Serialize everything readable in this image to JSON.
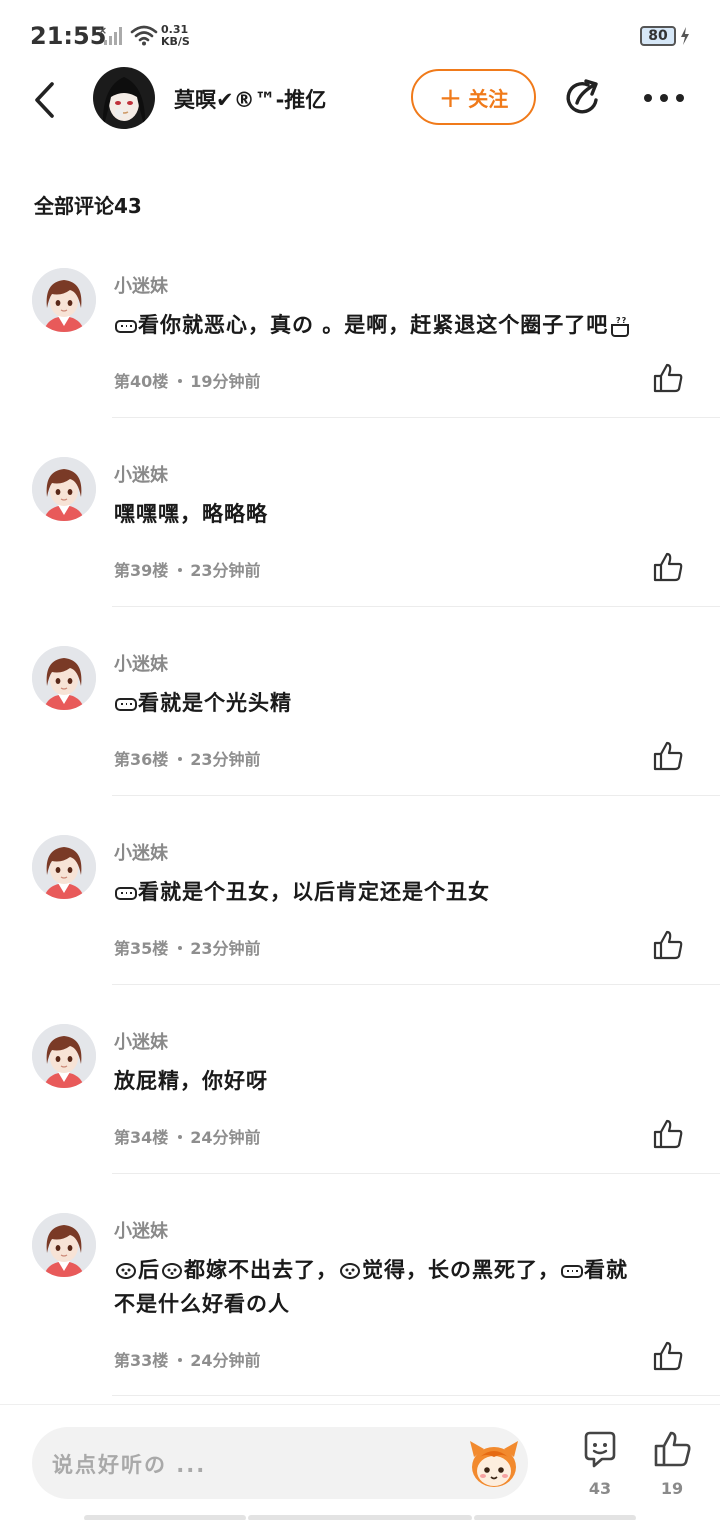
{
  "status_bar": {
    "time": "21:55",
    "net_speed_value": "0.31",
    "net_speed_unit": "KB/S",
    "battery": "80"
  },
  "header": {
    "author_name": "莫暝✔®™-推亿",
    "follow_label": "关注",
    "follow_plus": "+"
  },
  "section": {
    "title": "全部评论43"
  },
  "comments": [
    {
      "user": "小迷妹",
      "text": "看你就恶心，真の 。是啊，赶紧退这个圈子了吧",
      "floor": "第40楼",
      "time": "19分钟前"
    },
    {
      "user": "小迷妹",
      "text": "嘿嘿嘿，略略略",
      "floor": "第39楼",
      "time": "23分钟前"
    },
    {
      "user": "小迷妹",
      "text": "看就是个光头精",
      "floor": "第36楼",
      "time": "23分钟前"
    },
    {
      "user": "小迷妹",
      "text": "看就是个丑女，以后肯定还是个丑女",
      "floor": "第35楼",
      "time": "23分钟前"
    },
    {
      "user": "小迷妹",
      "text": "放屁精，你好呀",
      "floor": "第34楼",
      "time": "24分钟前"
    },
    {
      "user": "小迷妹",
      "text_parts": [
        "后",
        "都嫁不出去了，",
        "觉得，长の黑死了，",
        "看就"
      ],
      "text_line2": "不是什么好看の人",
      "floor": "第33楼",
      "time": "24分钟前"
    }
  ],
  "bottom_bar": {
    "input_placeholder": "说点好听の ...",
    "comment_count": "43",
    "like_count": "19"
  },
  "colors": {
    "accent": "#f07a1a",
    "muted_text": "#8a8a8a",
    "divider": "#ececec"
  },
  "icons": [
    "back-icon",
    "share-icon",
    "more-icon",
    "like-icon",
    "comment-icon",
    "mascot-icon",
    "signal-icon",
    "wifi-icon",
    "battery-icon"
  ]
}
